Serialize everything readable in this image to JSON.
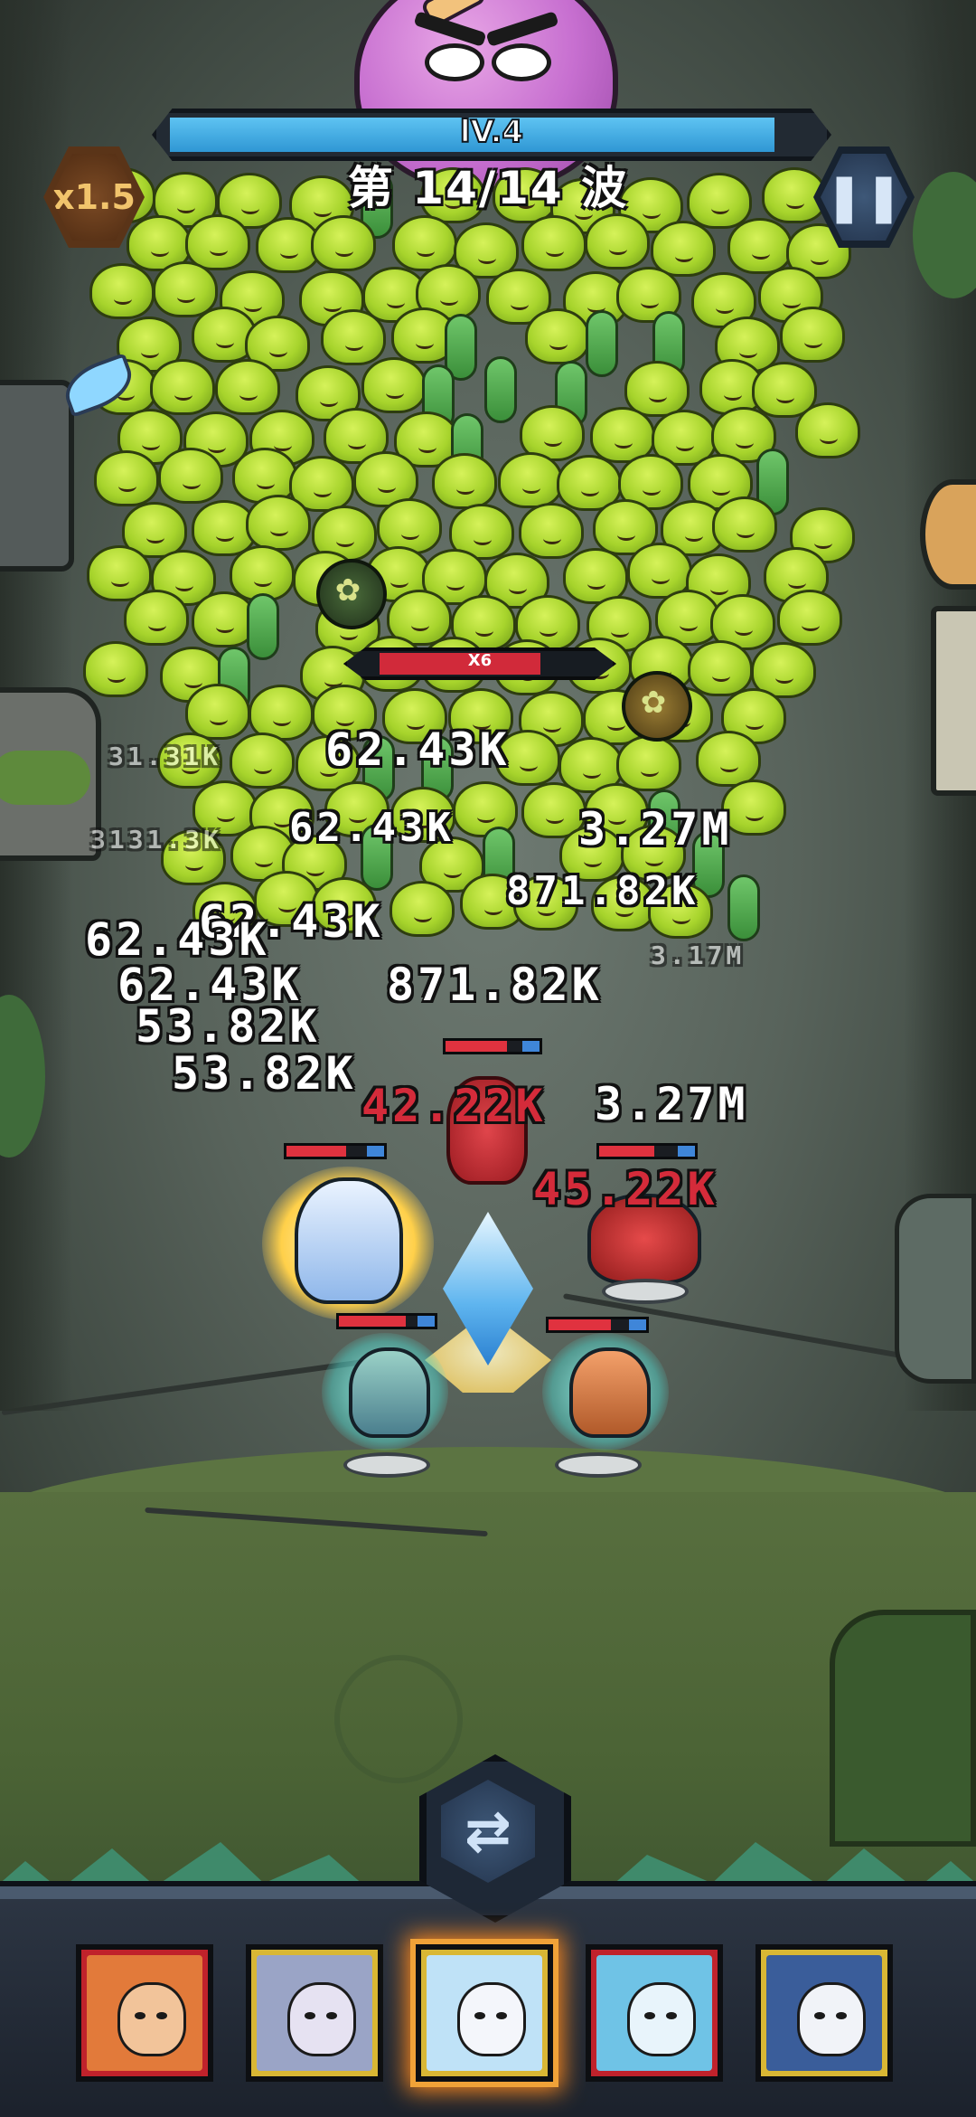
{
  "hud": {
    "level_label": "lV.4",
    "level_progress": 0.94,
    "wave_label": "第 14/14 波",
    "speed_label": "x1.5",
    "pause_icon": "pause-icon"
  },
  "elite": {
    "multiplier_label": "X6",
    "health_fraction": 0.8
  },
  "damage_numbers": [
    "62.43K",
    "3131.3K",
    "53.82K",
    "871.82K",
    "53.82K",
    "3.27M",
    "45.22K",
    "42.22K",
    "31.31K",
    "3.17M"
  ],
  "heroes": [
    {
      "name": "ice-queen-hero",
      "hp": 0.75
    },
    {
      "name": "crab-hero",
      "hp": 0.8
    },
    {
      "name": "lava-golem-hero",
      "hp": 0.7
    },
    {
      "name": "green-sorceress-hero",
      "hp": 0.85
    },
    {
      "name": "fox-warrior-hero",
      "hp": 0.78
    }
  ],
  "bottom": {
    "swap_icon": "swap-icon",
    "cards": [
      {
        "hero": "fox-warrior",
        "frame": "red",
        "selected": false
      },
      {
        "hero": "silver-mage",
        "frame": "gold",
        "selected": false
      },
      {
        "hero": "ice-queen",
        "frame": "gold",
        "selected": true
      },
      {
        "hero": "aqua-spirit",
        "frame": "red",
        "selected": false
      },
      {
        "hero": "paladin",
        "frame": "gold",
        "selected": false
      }
    ]
  },
  "colors": {
    "level_bar": "#2f97d4",
    "enemy_hp": "#d12a3a",
    "selected_glow": "#ff8a1e",
    "onion_green": "#a7d42c"
  }
}
